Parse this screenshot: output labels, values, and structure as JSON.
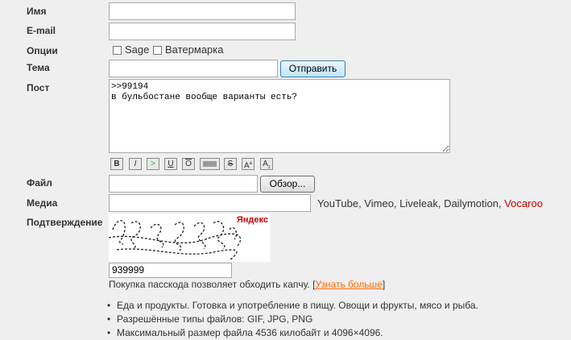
{
  "form": {
    "name_label": "Имя",
    "email_label": "E-mail",
    "options_label": "Опции",
    "sage_label": "Sage",
    "watermark_label": "Ватермарка",
    "subject_label": "Тема",
    "submit_label": "Отправить",
    "post_label": "Пост",
    "post_text": ">>99194\nв бульбостане вообще варианты есть?",
    "file_label": "Файл",
    "browse_label": "Обзор...",
    "media_label": "Медиа",
    "media_hint_main": "YouTube, Vimeo, Liveleak, Dailymotion,",
    "media_hint_extra": "Vocaroo",
    "media_hint_extra_color": "#cc0000",
    "confirm_label": "Подтверждение",
    "captcha_brand": "Яндекс",
    "captcha_value": "939999",
    "passcode_text": "Покупка пасскода позволяет обходить капчу.",
    "passcode_link": "Узнать больше",
    "format_buttons": [
      "B",
      "I",
      ">",
      "U",
      "O",
      "",
      "S",
      "A",
      "A"
    ]
  },
  "rules": [
    "Еда и продукты. Готовка и употребление в пищу. Овощи и фрукты, мясо и рыба.",
    "Разрешённые типы файлов: GIF, JPG, PNG",
    "Максимальный размер файла 4536 килобайт и 4096×4096."
  ]
}
